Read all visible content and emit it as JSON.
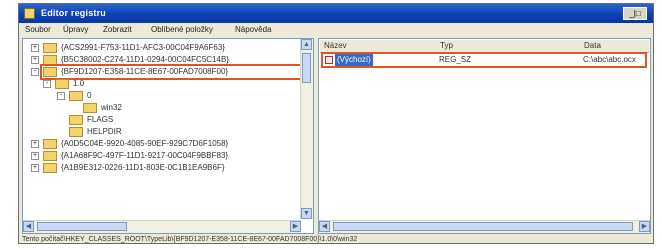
{
  "window": {
    "title": "Editor registru",
    "controls": "_|□"
  },
  "menu": [
    "Soubor",
    "Úpravy",
    "Zobrazit",
    "Oblíbené položky",
    "Nápověda"
  ],
  "tree": [
    {
      "level": 1,
      "expander": "+",
      "label": "{ACS2991-F753-11D1-AFC3-00C04F9A6F63}"
    },
    {
      "level": 1,
      "expander": "+",
      "label": "{B5C38002-C274-11D1-0294-00C04FC5C14B}"
    },
    {
      "level": 1,
      "expander": "-",
      "label": "{BF9D1207-E358-11CE-8E67-00FAD7008F00}"
    },
    {
      "level": 2,
      "expander": "-",
      "label": "1.0"
    },
    {
      "level": 3,
      "expander": "-",
      "label": "0"
    },
    {
      "level": 4,
      "expander": "",
      "label": "win32"
    },
    {
      "level": 3,
      "expander": "",
      "label": "FLAGS"
    },
    {
      "level": 3,
      "expander": "",
      "label": "HELPDIR"
    },
    {
      "level": 1,
      "expander": "+",
      "label": "{A0D5C04E-9920-4085-90EF-929C7D6F1058}"
    },
    {
      "level": 1,
      "expander": "+",
      "label": "{A1A68F9C-497F-11D1-9217-00C04F9BBF83}"
    },
    {
      "level": 1,
      "expander": "+",
      "label": "{A1B9E312-0226-11D1-803E-0C1B1EA9B6F}"
    }
  ],
  "list": {
    "columns": [
      "Název",
      "Typ",
      "Data"
    ],
    "rows": [
      {
        "name": "(Výchozí)",
        "type": "REG_SZ",
        "data": "C:\\abc\\abc.ocx"
      }
    ]
  },
  "status_text": "Tento počítač\\HKEY_CLASSES_ROOT\\TypeLib\\{BF9D1207-E358-11CE-8E67-00FAD7008F00}\\1.0\\0\\win32",
  "highlight_color": "#e0532a",
  "selection_color": "#316ac5"
}
